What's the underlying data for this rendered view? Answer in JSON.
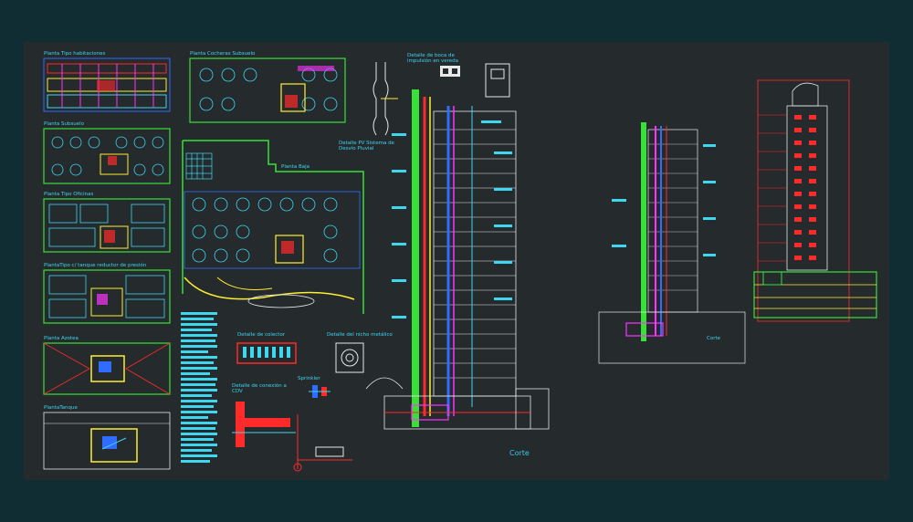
{
  "drawing": {
    "background": "#0f2d33",
    "sheet_color": "#252a2d",
    "colors": {
      "cyan": "#3fd6f0",
      "blue": "#2f6cff",
      "green": "#38e038",
      "red": "#ff2a2a",
      "yellow": "#ffee33",
      "magenta": "#ff33ff",
      "white": "#e8e8e8"
    }
  },
  "labels": {
    "planta_tipo_habitaciones": "Planta Tipo habitaciones",
    "planta_cocheras_subsuelo": "Planta Cocheras Subsuelo",
    "planta_subsuelo": "Planta Subsuelo",
    "planta_tipo_oficinas": "Planta Tipo Oficinas",
    "planta_tanque_reductor": "PlantaTipo c/ tanque reductor de presión",
    "planta_azotea": "Planta Azotea",
    "planta_tanque": "PlantaTanque",
    "planta_baja": "Planta Baja",
    "detalle_boca_impulsion": "Detalle de boca de impulsión en vereda",
    "detalle_pv": "Detalle PV Sistema de Desvío Pluvial",
    "detalle_colector": "Detalle de colector",
    "detalle_nicho": "Detalle del nicho metálico",
    "sprinkler": "Sprinkler",
    "detalle_conexion": "Detalle de conexión a CDV",
    "corte_main": "Corte",
    "corte_small": "Corte"
  }
}
